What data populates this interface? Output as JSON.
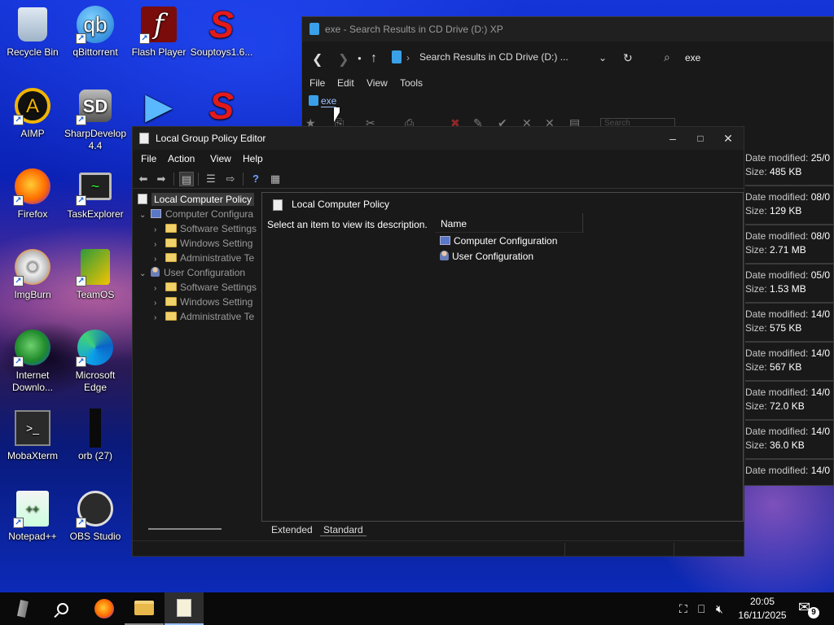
{
  "desktop": {
    "icons": [
      {
        "label": "Recycle Bin",
        "icon": "recycle-bin-icon"
      },
      {
        "label": "qBittorrent",
        "icon": "qbittorrent-icon",
        "glyph": "qb"
      },
      {
        "label": "Flash Player",
        "icon": "flash-player-icon",
        "glyph": "f"
      },
      {
        "label": "Souptoys1.6...",
        "icon": "souptoys-icon",
        "glyph": "S"
      },
      {
        "label": "AIMP",
        "icon": "aimp-icon",
        "glyph": "A"
      },
      {
        "label": "SharpDevelop 4.4",
        "icon": "sharpdevelop-icon",
        "glyph": "SD"
      },
      {
        "label": "Firefox",
        "icon": "firefox-icon"
      },
      {
        "label": "TaskExplorer",
        "icon": "taskexplorer-icon",
        "glyph": "~"
      },
      {
        "label": "ImgBurn",
        "icon": "imgburn-icon"
      },
      {
        "label": "TeamOS",
        "icon": "teamos-icon"
      },
      {
        "label": "Internet Downlo...",
        "icon": "idm-icon"
      },
      {
        "label": "Microsoft Edge",
        "icon": "edge-icon"
      },
      {
        "label": "MobaXterm",
        "icon": "mobaxterm-icon",
        "glyph": ">_"
      },
      {
        "label": "orb (27)",
        "icon": "orb-icon"
      },
      {
        "label": "Notepad++",
        "icon": "notepadpp-icon",
        "glyph": "++"
      },
      {
        "label": "OBS Studio",
        "icon": "obs-icon"
      }
    ]
  },
  "explorer": {
    "title": "exe - Search Results in CD Drive (D:) XP",
    "address": "Search Results in CD Drive (D:) ...",
    "search_value": "exe",
    "menu": [
      "File",
      "Edit",
      "View",
      "Tools"
    ],
    "tab_label": "exe",
    "toolbar_search_placeholder": "Search",
    "items": [
      {
        "date_label": "Date modified:",
        "date": "25/0",
        "size_label": "Size:",
        "size": "485 KB"
      },
      {
        "date_label": "Date modified:",
        "date": "08/0",
        "size_label": "Size:",
        "size": "129 KB"
      },
      {
        "date_label": "Date modified:",
        "date": "08/0",
        "size_label": "Size:",
        "size": "2.71 MB"
      },
      {
        "date_label": "Date modified:",
        "date": "05/0",
        "size_label": "Size:",
        "size": "1.53 MB"
      },
      {
        "date_label": "Date modified:",
        "date": "14/0",
        "size_label": "Size:",
        "size": "575 KB"
      },
      {
        "date_label": "Date modified:",
        "date": "14/0",
        "size_label": "Size:",
        "size": "567 KB"
      },
      {
        "date_label": "Date modified:",
        "date": "14/0",
        "size_label": "Size:",
        "size": "72.0 KB"
      },
      {
        "date_label": "Date modified:",
        "date": "14/0",
        "size_label": "Size:",
        "size": "36.0 KB"
      },
      {
        "date_label": "Date modified:",
        "date": "14/0",
        "size_label": "",
        "size": ""
      }
    ]
  },
  "gpe": {
    "title": "Local Group Policy Editor",
    "menu": [
      "File",
      "Action",
      "View",
      "Help"
    ],
    "tree": {
      "root": "Local Computer Policy",
      "computer": "Computer Configura",
      "computer_children": [
        "Software Settings",
        "Windows Setting",
        "Administrative Te"
      ],
      "user": "User Configuration",
      "user_children": [
        "Software Settings",
        "Windows Setting",
        "Administrative Te"
      ]
    },
    "right": {
      "header": "Local Computer Policy",
      "description": "Select an item to view its description.",
      "column_name": "Name",
      "rows": [
        "Computer Configuration",
        "User Configuration"
      ]
    },
    "bottom_tabs": [
      "Extended",
      "Standard"
    ]
  },
  "taskbar": {
    "time": "20:05",
    "date": "16/11/2025",
    "notification_count": "9"
  }
}
